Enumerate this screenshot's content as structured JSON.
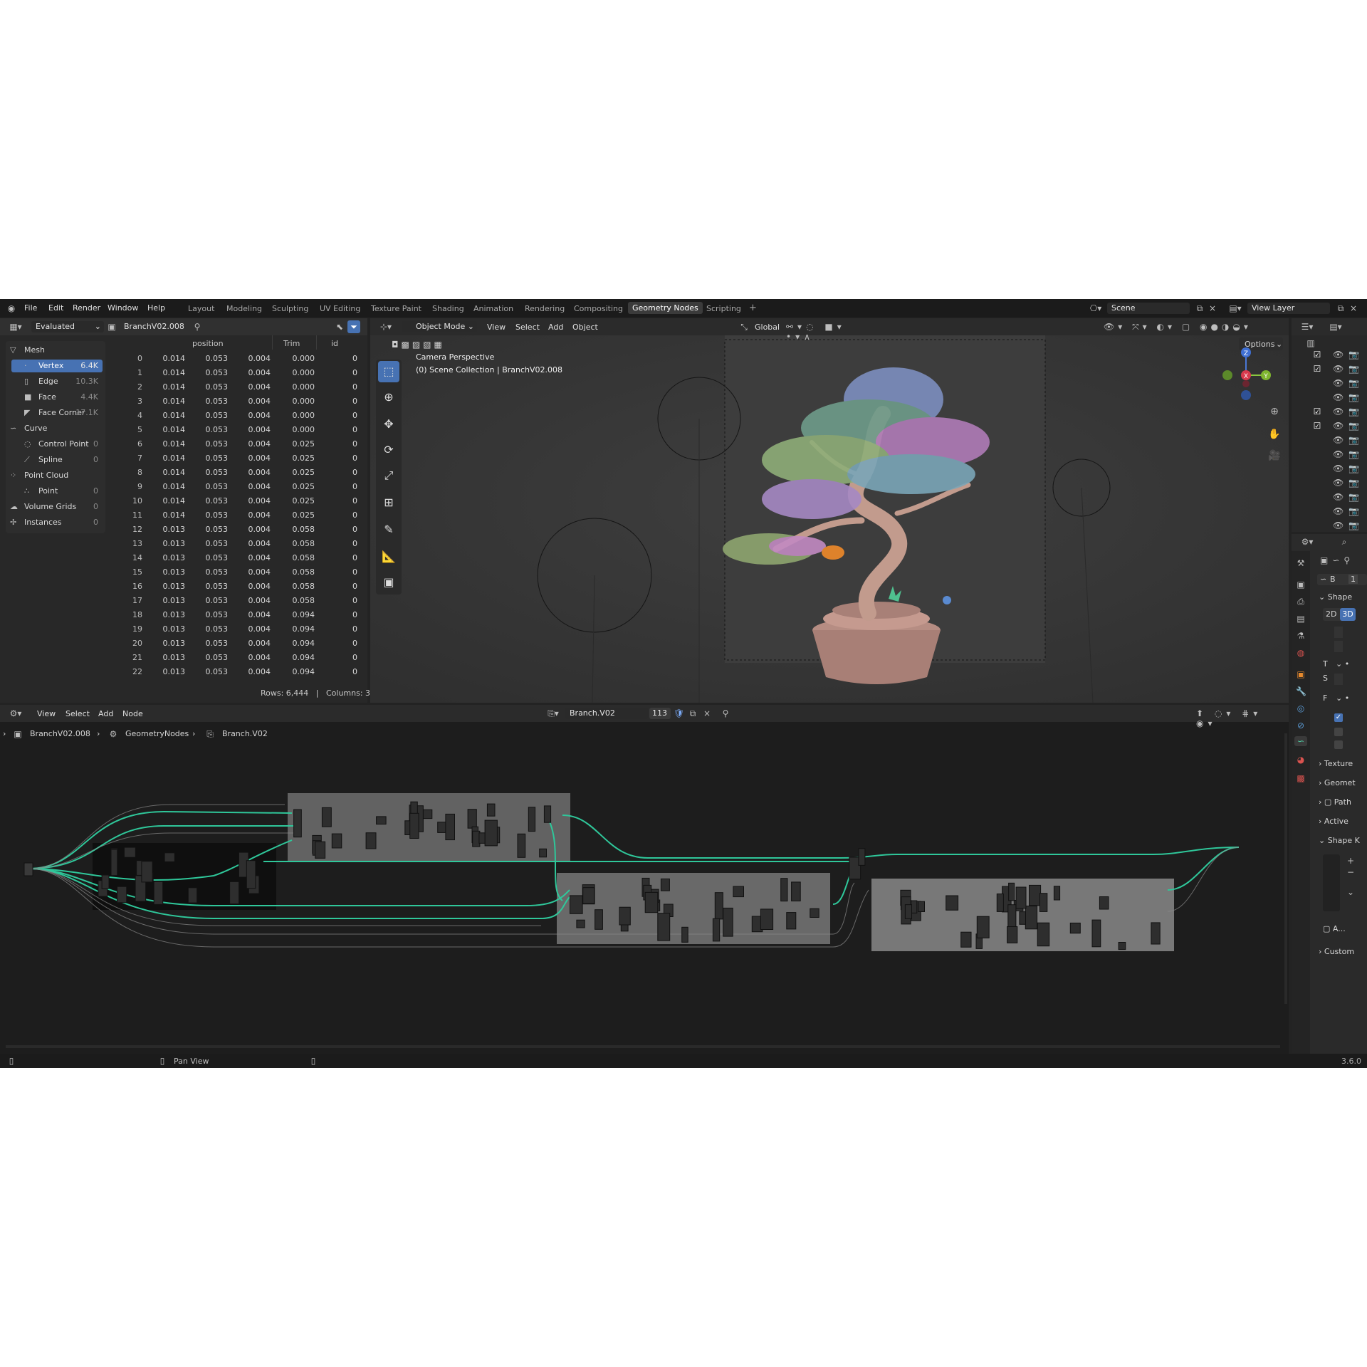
{
  "topbar": {
    "menus": [
      "File",
      "Edit",
      "Render",
      "Window",
      "Help"
    ],
    "workspaces": [
      "Layout",
      "Modeling",
      "Sculpting",
      "UV Editing",
      "Texture Paint",
      "Shading",
      "Animation",
      "Rendering",
      "Compositing",
      "Geometry Nodes",
      "Scripting"
    ],
    "active_workspace": "Geometry Nodes",
    "add_tab": "+",
    "scene": "Scene",
    "view_layer": "View Layer"
  },
  "spreadsheet": {
    "mode": "Evaluated",
    "object": "BranchV02.008",
    "columns": [
      "position",
      "Trim",
      "id"
    ],
    "tree": [
      {
        "label": "Mesh",
        "count": "",
        "indent": 0,
        "icon": "mesh-icon"
      },
      {
        "label": "Vertex",
        "count": "6.4K",
        "indent": 1,
        "selected": true,
        "icon": "vertex-icon"
      },
      {
        "label": "Edge",
        "count": "10.3K",
        "indent": 1,
        "icon": "edge-icon"
      },
      {
        "label": "Face",
        "count": "4.4K",
        "indent": 1,
        "icon": "face-icon"
      },
      {
        "label": "Face Corner",
        "count": "17.1K",
        "indent": 1,
        "icon": "face-corner-icon"
      },
      {
        "label": "Curve",
        "count": "",
        "indent": 0,
        "icon": "curve-icon"
      },
      {
        "label": "Control Point",
        "count": "0",
        "indent": 1,
        "icon": "control-point-icon"
      },
      {
        "label": "Spline",
        "count": "0",
        "indent": 1,
        "icon": "spline-icon"
      },
      {
        "label": "Point Cloud",
        "count": "",
        "indent": 0,
        "icon": "point-cloud-icon"
      },
      {
        "label": "Point",
        "count": "0",
        "indent": 1,
        "icon": "point-icon"
      },
      {
        "label": "Volume Grids",
        "count": "0",
        "indent": 0,
        "icon": "volume-icon"
      },
      {
        "label": "Instances",
        "count": "0",
        "indent": 0,
        "icon": "instances-icon"
      }
    ],
    "rows": [
      [
        "0",
        "0.014",
        "0.053",
        "0.004",
        "0.000",
        "0"
      ],
      [
        "1",
        "0.014",
        "0.053",
        "0.004",
        "0.000",
        "0"
      ],
      [
        "2",
        "0.014",
        "0.053",
        "0.004",
        "0.000",
        "0"
      ],
      [
        "3",
        "0.014",
        "0.053",
        "0.004",
        "0.000",
        "0"
      ],
      [
        "4",
        "0.014",
        "0.053",
        "0.004",
        "0.000",
        "0"
      ],
      [
        "5",
        "0.014",
        "0.053",
        "0.004",
        "0.000",
        "0"
      ],
      [
        "6",
        "0.014",
        "0.053",
        "0.004",
        "0.025",
        "0"
      ],
      [
        "7",
        "0.014",
        "0.053",
        "0.004",
        "0.025",
        "0"
      ],
      [
        "8",
        "0.014",
        "0.053",
        "0.004",
        "0.025",
        "0"
      ],
      [
        "9",
        "0.014",
        "0.053",
        "0.004",
        "0.025",
        "0"
      ],
      [
        "10",
        "0.014",
        "0.053",
        "0.004",
        "0.025",
        "0"
      ],
      [
        "11",
        "0.014",
        "0.053",
        "0.004",
        "0.025",
        "0"
      ],
      [
        "12",
        "0.013",
        "0.053",
        "0.004",
        "0.058",
        "0"
      ],
      [
        "13",
        "0.013",
        "0.053",
        "0.004",
        "0.058",
        "0"
      ],
      [
        "14",
        "0.013",
        "0.053",
        "0.004",
        "0.058",
        "0"
      ],
      [
        "15",
        "0.013",
        "0.053",
        "0.004",
        "0.058",
        "0"
      ],
      [
        "16",
        "0.013",
        "0.053",
        "0.004",
        "0.058",
        "0"
      ],
      [
        "17",
        "0.013",
        "0.053",
        "0.004",
        "0.058",
        "0"
      ],
      [
        "18",
        "0.013",
        "0.053",
        "0.004",
        "0.094",
        "0"
      ],
      [
        "19",
        "0.013",
        "0.053",
        "0.004",
        "0.094",
        "0"
      ],
      [
        "20",
        "0.013",
        "0.053",
        "0.004",
        "0.094",
        "0"
      ],
      [
        "21",
        "0.013",
        "0.053",
        "0.004",
        "0.094",
        "0"
      ],
      [
        "22",
        "0.013",
        "0.053",
        "0.004",
        "0.094",
        "0"
      ]
    ],
    "footer": "Rows: 6,444   |   Columns: 3"
  },
  "viewport": {
    "mode": "Object Mode",
    "menus": [
      "View",
      "Select",
      "Add",
      "Object"
    ],
    "transform": "Global",
    "options": "Options",
    "overlay_line1": "Camera Perspective",
    "overlay_line2": "(0) Scene Collection | BranchV02.008",
    "gizmo": {
      "z": "Z",
      "x": "X",
      "y": "Y"
    }
  },
  "node_editor": {
    "menus": [
      "View",
      "Select",
      "Add",
      "Node"
    ],
    "node_group": "Branch.V02",
    "users": "113",
    "breadcrumb": [
      "BranchV02.008",
      "GeometryNodes",
      "Branch.V02"
    ]
  },
  "properties": {
    "sub_labels": [
      "B",
      "1"
    ],
    "panels": [
      "Shape",
      "Texture",
      "Geomet",
      "Path",
      "Active",
      "Shape K",
      "Custom"
    ],
    "dim_2d": "2D",
    "dim_3d": "3D",
    "letters": [
      "T",
      "S",
      "F"
    ],
    "shape_key_item": "A..."
  },
  "statusbar": {
    "hint": "Pan View",
    "version": "3.6.0"
  },
  "colors": {
    "accent": "#4772b3",
    "node_link": "#2fc79a",
    "frame": "#7a7a7a"
  }
}
